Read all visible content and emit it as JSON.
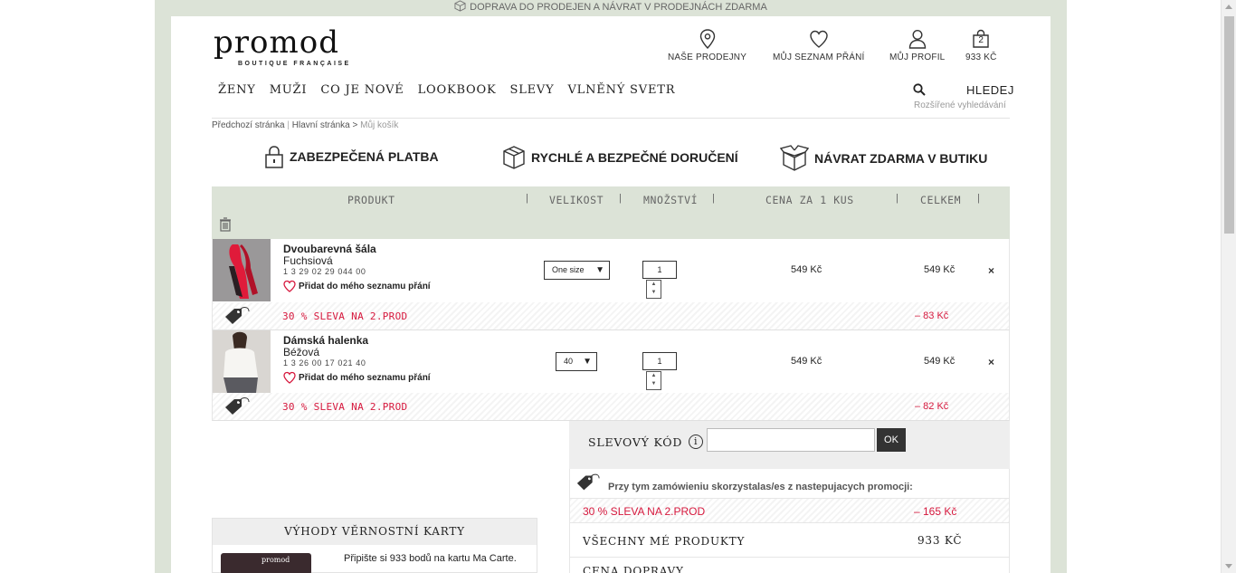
{
  "top_banner": "DOPRAVA DO PRODEJEN A NÁVRAT V PRODEJNÁCH ZDARMA",
  "logo": {
    "word": "promod",
    "tagline": "BOUTIQUE FRANÇAISE"
  },
  "header_links": {
    "stores": "NAŠE PRODEJNY",
    "wishlist": "MŮJ SEZNAM PŘÁNÍ",
    "profile": "MŮJ PROFIL",
    "cart_count": "2",
    "cart_total": "933 KČ"
  },
  "nav": [
    "ŽENY",
    "MUŽI",
    "CO JE NOVÉ",
    "LOOKBOOK",
    "SLEVY",
    "VLNĚNÝ SVETR"
  ],
  "search": {
    "label": "HLEDEJ",
    "advanced": "Rozšířené vyhledávání"
  },
  "breadcrumb": {
    "prev": "Předchozí stránka",
    "sep1": "|",
    "home": "Hlavní stránka",
    "sep2": ">",
    "current": "Můj košík"
  },
  "assurances": {
    "secure": "ZABEZPEČENÁ PLATBA",
    "delivery": "RYCHLÉ A BEZPEČNÉ DORUČENÍ",
    "returns": "NÁVRAT ZDARMA V BUTIKU"
  },
  "cart_header": {
    "product": "PRODUKT",
    "size": "VELIKOST",
    "quantity": "MNOŽSTVÍ",
    "unit_price": "CENA ZA 1 KUS",
    "total": "CELKEM",
    "separator": "|"
  },
  "items": [
    {
      "name": "Dvoubarevná šála",
      "color": "Fuchsiová",
      "ref": "1 3 29 02 29 044 00",
      "wishlist": "Přidat do mého seznamu přání",
      "size": "One size",
      "qty": "1",
      "unit_price": "549 Kč",
      "total": "549 Kč",
      "remove": "×",
      "promo_label": "30 % SLEVA NA 2.PROD",
      "promo_amount": "– 83 Kč"
    },
    {
      "name": "Dámská halenka",
      "color": "Béžová",
      "ref": "1 3 26 00 17 021 40",
      "wishlist": "Přidat do mého seznamu přání",
      "size": "40",
      "qty": "1",
      "unit_price": "549 Kč",
      "total": "549 Kč",
      "remove": "×",
      "promo_label": "30 % SLEVA NA 2.PROD",
      "promo_amount": "– 82 Kč"
    }
  ],
  "voucher": {
    "label": "SLEVOVÝ KÓD",
    "info": "i",
    "button": "OK",
    "value": ""
  },
  "summary": {
    "promotions_used": "Przy tym zamówieniu skorzystalas/es z nastepujacych promocji:",
    "promo_label": "30 % SLEVA NA 2.PROD",
    "promo_amount": "–  165 Kč",
    "all_products_label": "VŠECHNY MÉ PRODUKTY",
    "all_products_value": "933 KČ",
    "shipping_label": "CENA DOPRAVY"
  },
  "loyalty": {
    "title": "VÝHODY VĚRNOSTNÍ KARTY",
    "card_brand": "promod",
    "text": "Připište si 933 bodů na kartu Ma Carte."
  },
  "colors": {
    "accent_green": "#dce3d7",
    "promo_red": "#d6183d"
  }
}
